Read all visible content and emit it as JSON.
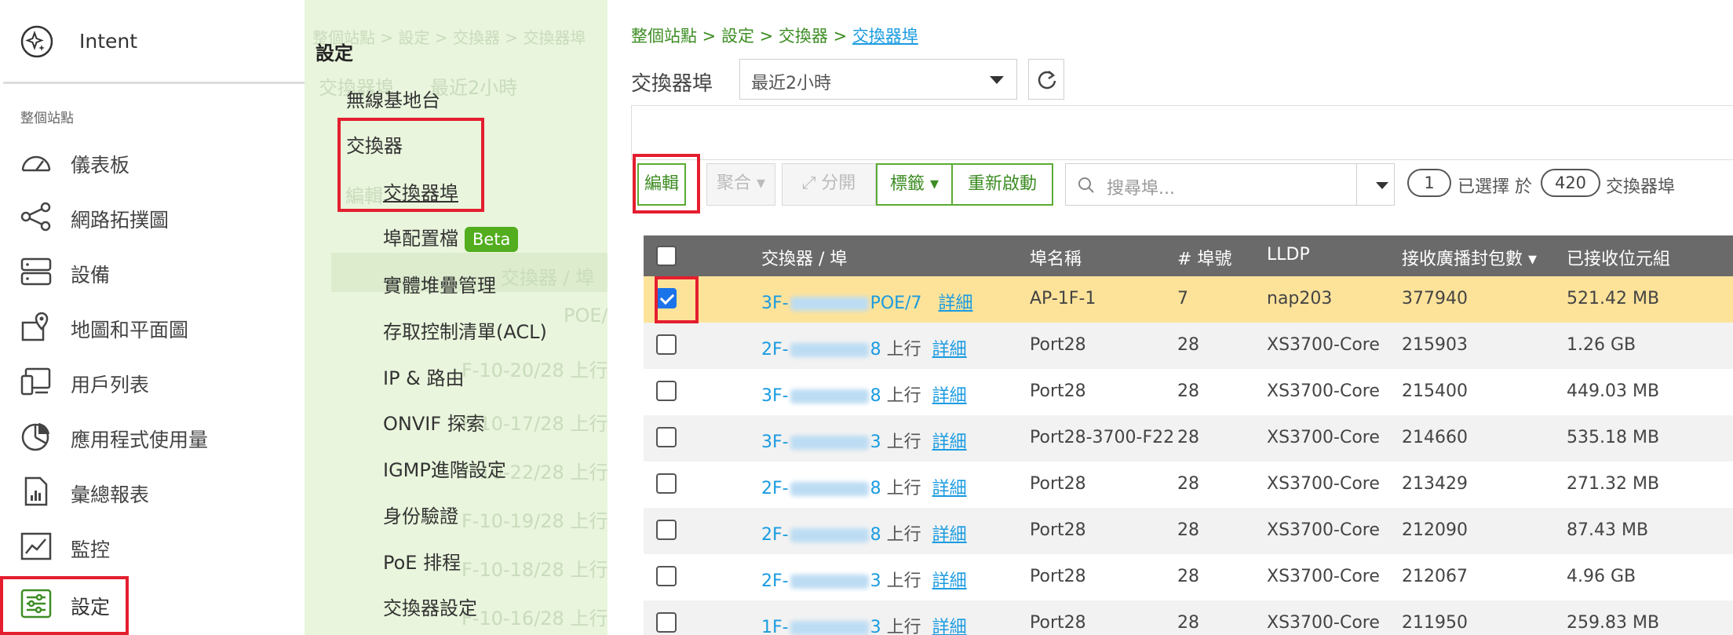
{
  "left_nav": {
    "intent_label": "Intent",
    "section_title": "整個站點",
    "items": [
      {
        "label": "儀表板",
        "icon": "gauge-icon"
      },
      {
        "label": "網路拓撲圖",
        "icon": "topology-icon"
      },
      {
        "label": "設備",
        "icon": "server-icon"
      },
      {
        "label": "地圖和平面圖",
        "icon": "map-pin-icon"
      },
      {
        "label": "用戶列表",
        "icon": "client-icon"
      },
      {
        "label": "應用程式使用量",
        "icon": "pie-chart-icon"
      },
      {
        "label": "彙總報表",
        "icon": "report-icon"
      },
      {
        "label": "監控",
        "icon": "line-chart-icon"
      },
      {
        "label": "設定",
        "icon": "sliders-icon"
      }
    ]
  },
  "settings_panel": {
    "title": "設定",
    "items": [
      {
        "label": "無線基地台"
      },
      {
        "label": "交換器"
      },
      {
        "label": "交換器埠"
      },
      {
        "label": "埠配置檔",
        "badge": "Beta"
      },
      {
        "label": "實體堆疊管理"
      },
      {
        "label": "存取控制清單(ACL)"
      },
      {
        "label": "IP & 路由"
      },
      {
        "label": "ONVIF 探索"
      },
      {
        "label": "IGMP進階設定"
      },
      {
        "label": "身份驗證"
      },
      {
        "label": "PoE 排程"
      },
      {
        "label": "交換器設定"
      }
    ],
    "ghost_texts": [
      "整個站點 > 設定 > 交換器 > 交換器埠",
      "交換器埠",
      "最近2小時",
      "編輯",
      "交換器 / 埠",
      "POE/",
      "F-10-20/28 上行",
      "F-10-17/28 上行",
      "F-10-22/28 上行",
      "F-10-19/28 上行",
      "F-10-18/28 上行",
      "F-10-16/28 上行"
    ]
  },
  "main": {
    "breadcrumb": [
      "整個站點",
      "設定",
      "交換器",
      "交換器埠"
    ],
    "page_label": "交換器埠",
    "time_range": "最近2小時",
    "toolbar": {
      "edit": "編輯",
      "aggregate": "聚合",
      "split": "分開",
      "tag": "標籤",
      "restart": "重新啟動",
      "search_placeholder": "搜尋埠...",
      "selected_count": "1",
      "selected_label": "已選擇 於",
      "total_count": "420",
      "total_label": "交換器埠"
    },
    "table": {
      "headers": [
        "交換器 / 埠",
        "埠名稱",
        "# 埠號",
        "LLDP",
        "接收廣播封包數",
        "已接收位元組"
      ],
      "rows": [
        {
          "sw_a": "3F-",
          "sw_b": "POE/7",
          "uplink": "",
          "detail": "詳細",
          "port_name": "AP-1F-1",
          "port_no": "7",
          "lldp": "nap203",
          "bcast": "377940",
          "bytes": "521.42 MB",
          "checked": true
        },
        {
          "sw_a": "2F-",
          "sw_b": "8",
          "uplink": "上行",
          "detail": "詳細",
          "port_name": "Port28",
          "port_no": "28",
          "lldp": "XS3700-Core",
          "bcast": "215903",
          "bytes": "1.26 GB",
          "checked": false
        },
        {
          "sw_a": "3F-",
          "sw_b": "8",
          "uplink": "上行",
          "detail": "詳細",
          "port_name": "Port28",
          "port_no": "28",
          "lldp": "XS3700-Core",
          "bcast": "215400",
          "bytes": "449.03 MB",
          "checked": false
        },
        {
          "sw_a": "3F-",
          "sw_b": "3",
          "uplink": "上行",
          "detail": "詳細",
          "port_name": "Port28-3700-F22",
          "port_no": "28",
          "lldp": "XS3700-Core",
          "bcast": "214660",
          "bytes": "535.18 MB",
          "checked": false
        },
        {
          "sw_a": "2F-",
          "sw_b": "8",
          "uplink": "上行",
          "detail": "詳細",
          "port_name": "Port28",
          "port_no": "28",
          "lldp": "XS3700-Core",
          "bcast": "213429",
          "bytes": "271.32 MB",
          "checked": false
        },
        {
          "sw_a": "2F-",
          "sw_b": "8",
          "uplink": "上行",
          "detail": "詳細",
          "port_name": "Port28",
          "port_no": "28",
          "lldp": "XS3700-Core",
          "bcast": "212090",
          "bytes": "87.43 MB",
          "checked": false
        },
        {
          "sw_a": "2F-",
          "sw_b": "3",
          "uplink": "上行",
          "detail": "詳細",
          "port_name": "Port28",
          "port_no": "28",
          "lldp": "XS3700-Core",
          "bcast": "212067",
          "bytes": "4.96 GB",
          "checked": false
        },
        {
          "sw_a": "1F-",
          "sw_b": "3",
          "uplink": "上行",
          "detail": "詳細",
          "port_name": "Port28",
          "port_no": "28",
          "lldp": "XS3700-Core",
          "bcast": "211950",
          "bytes": "259.83 MB",
          "checked": false
        }
      ]
    }
  },
  "colors": {
    "accent": "#52ad1f",
    "highlight_box": "#e41e2f",
    "link": "#1a9be0",
    "selected_row": "#fde39a",
    "settings_bg": "#e9f5dc",
    "header_bg": "#6a6a6a"
  }
}
